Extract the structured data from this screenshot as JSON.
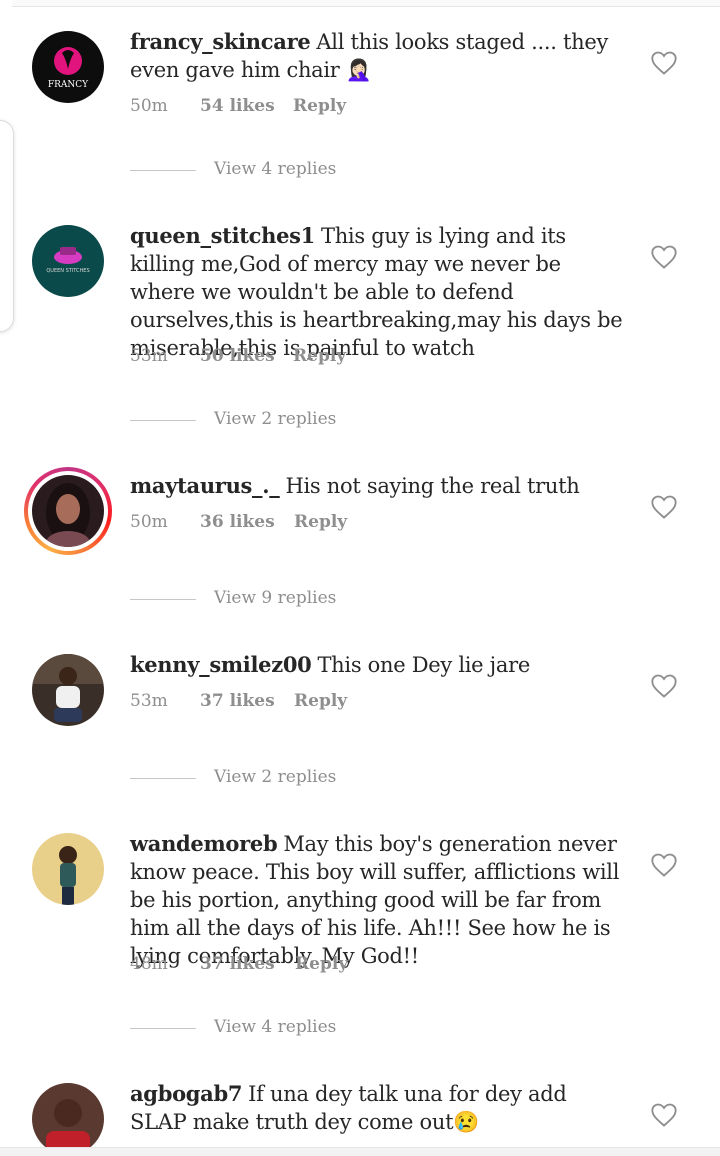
{
  "comments": [
    {
      "username": "francy_skincare",
      "text": "All this looks staged .... they even gave him chair 🤦🏻‍♀️",
      "time": "50m",
      "likes": "54 likes",
      "reply": "Reply",
      "view_replies": "View 4 replies",
      "avatar_logo_text": "FRANCY"
    },
    {
      "username": "queen_stitches1",
      "text": "This guy is lying and its killing me,God of mercy may we never be where we wouldn't be able to defend ourselves,this is heartbreaking,may his days be miserable,this is painful to watch",
      "time": "53m",
      "likes": "50 likes",
      "reply": "Reply",
      "view_replies": "View 2 replies",
      "avatar_logo_text": "QUEEN STITCHES"
    },
    {
      "username": "maytaurus_._",
      "text": "His not saying the real truth",
      "time": "50m",
      "likes": "36 likes",
      "reply": "Reply",
      "view_replies": "View 9 replies"
    },
    {
      "username": "kenny_smilez00",
      "text": "This one Dey lie jare",
      "time": "53m",
      "likes": "37 likes",
      "reply": "Reply",
      "view_replies": "View 2 replies"
    },
    {
      "username": "wandemoreb",
      "text": "May this boy's generation never know peace. This boy will suffer, afflictions will be his portion, anything good will be far from him all the days of his life. Ah!!! See how he is lying comfortably. My God!!",
      "time": "48m",
      "likes": "37 likes",
      "reply": "Reply",
      "view_replies": "View 4 replies"
    },
    {
      "username": "agbogab7",
      "text": "If una dey talk una for dey add SLAP make truth dey come out😢"
    }
  ],
  "icons": {
    "like": "heart-outline-icon"
  },
  "colors": {
    "meta_text": "#8e8e8e",
    "primary_text": "#262626",
    "story_ring": "#e1306c"
  }
}
